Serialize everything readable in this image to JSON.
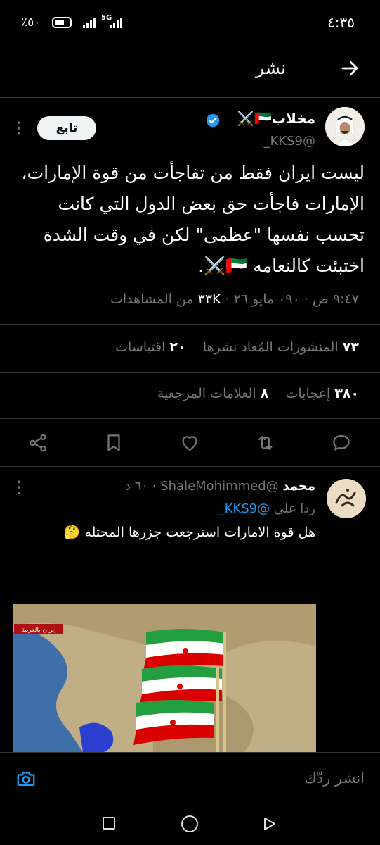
{
  "status_bar": {
    "time": "٤:٣٥",
    "battery_percent": "٪٥٠",
    "network": "5G"
  },
  "header": {
    "title": "نشر",
    "back_icon": "arrow-right-icon"
  },
  "post": {
    "author_name": "مخلاب🇦🇪⚔️",
    "handle": "_KKS9@",
    "follow_label": "تابع",
    "text_lines": [
      "ليست ايران فقط من تفاجأت من قوة الإمارات،",
      "الإمارات فاجأت حق بعض الدول التي كانت",
      "تحسب نفسها \"عظمى\" لكن في وقت الشدة",
      "اختبئت كالنعامه 🇦🇪⚔️."
    ],
    "time": "٩:٤٧ ص",
    "date": "٠٩٠ مايو ٢٦",
    "views_count": "٣٣K",
    "views_label": "من المشاهدات",
    "reposts_count": "٧٣",
    "reposts_label": "المنشورات المُعاد نشرها",
    "quotes_count": "٢٠",
    "quotes_label": "اقتباسات",
    "likes_count": "٣٨٠",
    "likes_label": "إعجابات",
    "bookmarks_count": "٨",
    "bookmarks_label": "العلامات المرجعية",
    "verified_color": "#1d9bf0"
  },
  "actions": [
    "reply-icon",
    "repost-icon",
    "like-icon",
    "bookmark-icon",
    "share-icon"
  ],
  "reply": {
    "name": "محمد",
    "handle": "@ShaleMohimmed",
    "time": "٦٠ د",
    "replying_prefix": "ردا على",
    "replying_to": "@KKS9_",
    "text": "هل قوة الامارات استرجعت جزرها المحتله 🤔",
    "media_logo_text": "إيران بالعربية"
  },
  "compose": {
    "placeholder": "انشر ردّك"
  },
  "accent_color": "#1d9bf0"
}
